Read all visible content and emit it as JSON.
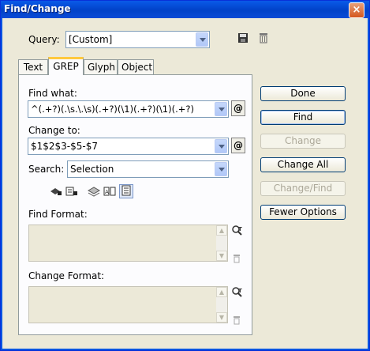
{
  "window": {
    "title": "Find/Change",
    "close_glyph": "×"
  },
  "query": {
    "label": "Query:",
    "value": "[Custom]",
    "save_icon": "save-query-icon",
    "delete_icon": "delete-query-icon"
  },
  "tabs": [
    {
      "label": "Text",
      "active": false
    },
    {
      "label": "GREP",
      "active": true
    },
    {
      "label": "Glyph",
      "active": false
    },
    {
      "label": "Object",
      "active": false
    }
  ],
  "find_what": {
    "label": "Find what:",
    "value": "^(.+?)(.\\s.\\.\\s)(.+?)(\\1)(.+?)(\\1)(.+?)"
  },
  "change_to": {
    "label": "Change to:",
    "value": "$1$2$3-$5-$7"
  },
  "search": {
    "label": "Search:",
    "value": "Selection"
  },
  "special_char_button": "@",
  "options_icons": [
    "include-locked-layers-icon",
    "include-locked-stories-icon",
    "include-hidden-layers-icon",
    "include-master-pages-icon",
    "include-footnotes-icon"
  ],
  "find_format": {
    "label": "Find Format:"
  },
  "change_format": {
    "label": "Change Format:"
  },
  "buttons": {
    "done": "Done",
    "find": "Find",
    "change": "Change",
    "change_all": "Change All",
    "change_find": "Change/Find",
    "fewer_options": "Fewer Options"
  }
}
